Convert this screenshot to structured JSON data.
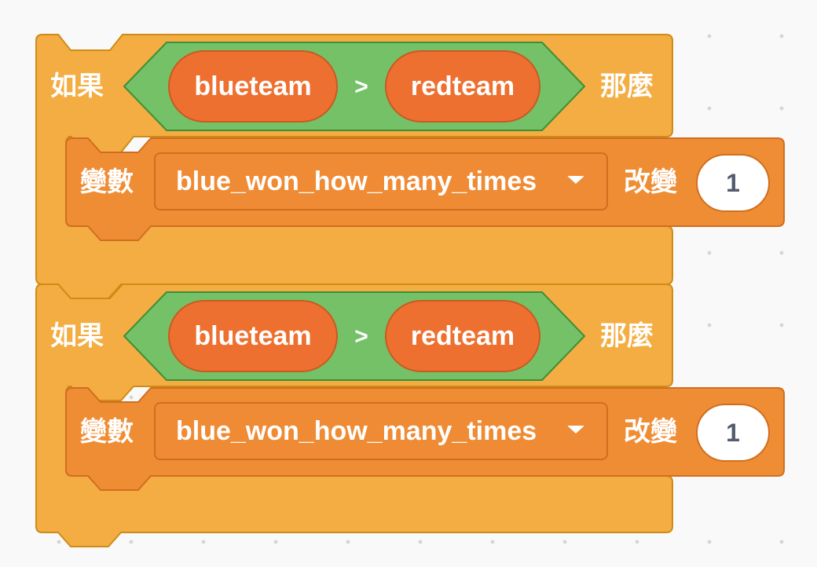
{
  "colors": {
    "control": "#f4ad42",
    "control_border": "#cf8b17",
    "variables": "#ef8d35",
    "variables_border": "#d06e20",
    "operator": "#74c168",
    "operator_border": "#3f8e36",
    "reporter": "#ee7030"
  },
  "blocks": [
    {
      "if_label": "如果",
      "then_label": "那麼",
      "condition": {
        "left": "blueteam",
        "operator": ">",
        "right": "redteam"
      },
      "change": {
        "variable_label": "變數",
        "variable": "blue_won_how_many_times",
        "change_label": "改變",
        "value": "1"
      }
    },
    {
      "if_label": "如果",
      "then_label": "那麼",
      "condition": {
        "left": "blueteam",
        "operator": ">",
        "right": "redteam"
      },
      "change": {
        "variable_label": "變數",
        "variable": "blue_won_how_many_times",
        "change_label": "改變",
        "value": "1"
      }
    }
  ]
}
